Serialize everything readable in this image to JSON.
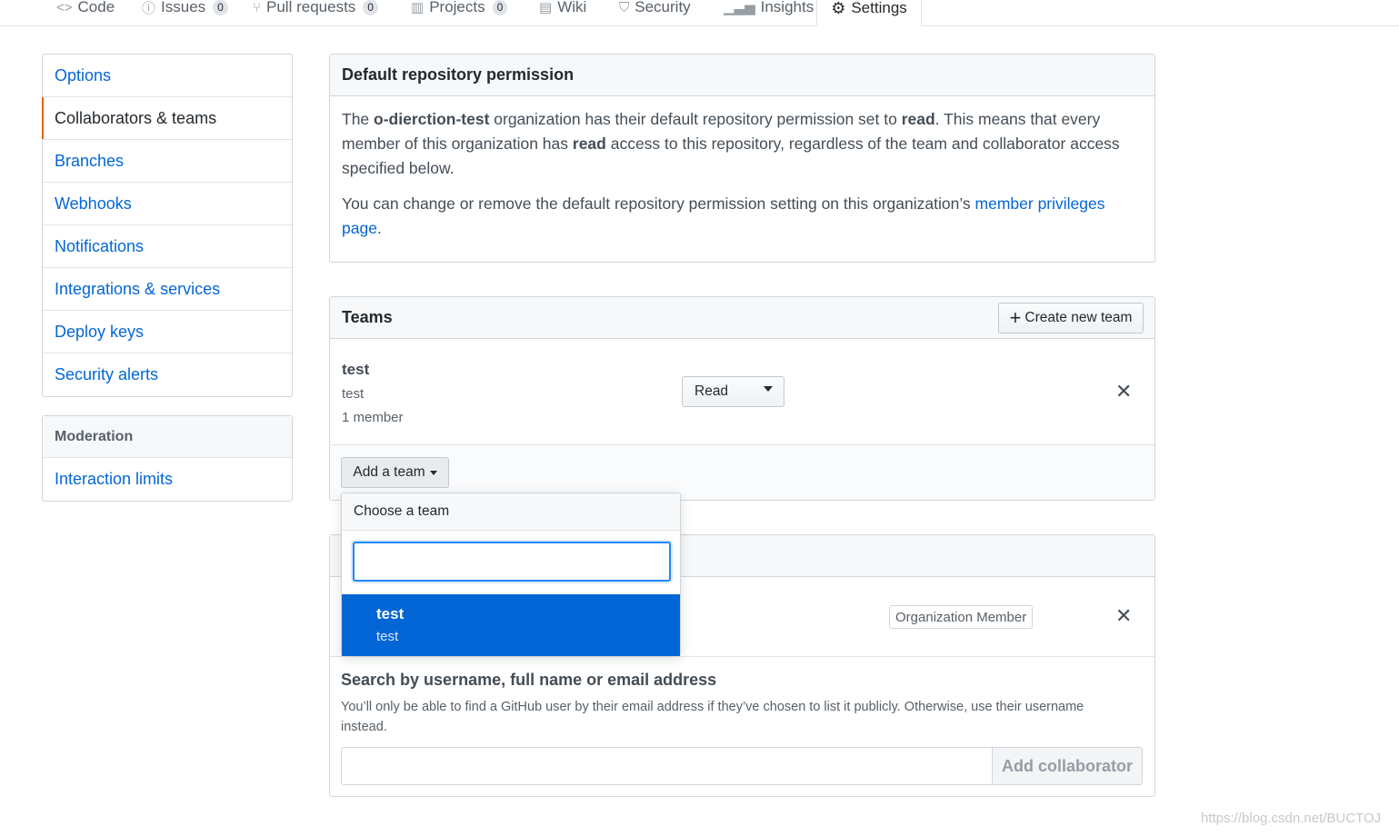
{
  "tabs": [
    {
      "label": "Code",
      "icon": "code-icon"
    },
    {
      "label": "Issues",
      "icon": "issue-icon",
      "count": "0"
    },
    {
      "label": "Pull requests",
      "icon": "pull-request-icon",
      "count": "0"
    },
    {
      "label": "Projects",
      "icon": "project-icon",
      "count": "0"
    },
    {
      "label": "Wiki",
      "icon": "book-icon"
    },
    {
      "label": "Security",
      "icon": "shield-icon"
    },
    {
      "label": "Insights",
      "icon": "graph-icon"
    },
    {
      "label": "Settings",
      "icon": "gear-icon",
      "selected": true
    }
  ],
  "menu": {
    "items": [
      "Options",
      "Collaborators & teams",
      "Branches",
      "Webhooks",
      "Notifications",
      "Integrations & services",
      "Deploy keys",
      "Security alerts"
    ],
    "selected": "Collaborators & teams"
  },
  "moderation": {
    "heading": "Moderation",
    "items": [
      "Interaction limits"
    ]
  },
  "permission": {
    "title": "Default repository permission",
    "p1_start": "The ",
    "org": "o-dierction-test",
    "p1_mid": " organization has their default repository permission set to ",
    "level": "read",
    "p1_mid2": ". This means that every member of this organization has ",
    "level2": "read",
    "p1_end": " access to this repository, regardless of the team and collaborator access specified below.",
    "p2_start": "You can change or remove the default repository permission setting on this organization’s ",
    "p2_link": "member privileges page",
    "p2_end": "."
  },
  "teams": {
    "title": "Teams",
    "create_label": "Create new team",
    "team": {
      "name": "test",
      "description": "test",
      "members": "1 member",
      "permission": "Read"
    },
    "add_label": "Add a team"
  },
  "dropdown": {
    "header": "Choose a team",
    "input_value": "",
    "item_title": "test",
    "item_sub": "test"
  },
  "collaborators": {
    "badge": "Organization Member",
    "search_title": "Search by username, full name or email address",
    "search_note": "You’ll only be able to find a GitHub user by their email address if they’ve chosen to list it publicly. Otherwise, use their username instead.",
    "input_value": "",
    "add_label": "Add collaborator"
  },
  "watermark": "https://blog.csdn.net/BUCTOJ",
  "colors": {
    "link": "#0366d6",
    "accent": "#e36209",
    "selected_bg": "#0366d6"
  }
}
